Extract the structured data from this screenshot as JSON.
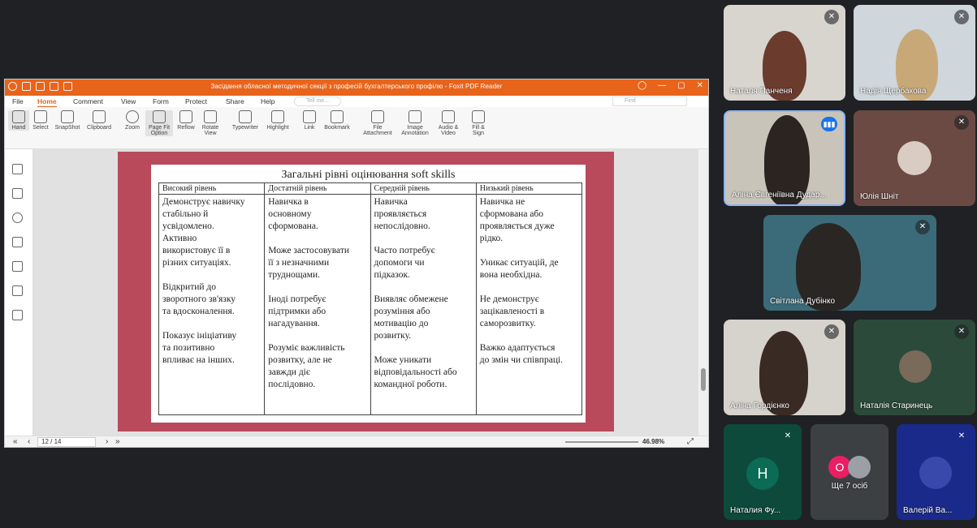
{
  "app": {
    "window_title": "Засідання обласної методичної секції з професій бухгалтерського профілю - Foxit PDF Reader"
  },
  "menu": [
    "File",
    "Home",
    "Comment",
    "View",
    "Form",
    "Protect",
    "Share",
    "Help"
  ],
  "tell_me_placeholder": "Tell me...",
  "find_placeholder": "Find",
  "ribbon": [
    {
      "label": "Hand"
    },
    {
      "label": "Select"
    },
    {
      "label": "SnapShot"
    },
    {
      "label": "Clipboard"
    },
    {
      "label": "Zoom"
    },
    {
      "label": "Page Fit Option"
    },
    {
      "label": "Reflow"
    },
    {
      "label": "Rotate View"
    },
    {
      "label": "Typewriter"
    },
    {
      "label": "Highlight"
    },
    {
      "label": "Link"
    },
    {
      "label": "Bookmark"
    },
    {
      "label": "File Attachment"
    },
    {
      "label": "Image Annotation"
    },
    {
      "label": "Audio & Video"
    },
    {
      "label": "Fill & Sign"
    }
  ],
  "status": {
    "page": "12 / 14",
    "zoom": "46.98%"
  },
  "slide": {
    "title": "Загальні рівні оцінювання soft skills",
    "columns": [
      {
        "header": "Високий рівень",
        "body": "Демонструє навичку\nстабільно й\nусвідомлено.\nАктивно\nвикористовує її в\nрізних ситуаціях.\n\nВідкритий до\nзворотного зв'язку\nта вдосконалення.\n\nПоказує ініціативу\nта позитивно\nвпливає на інших."
      },
      {
        "header": "Достатній рівень",
        "body": "Навичка в\nосновному\nсформована.\n\nМоже застосовувати\nїї з незначними\nтруднощами.\n\nІноді потребує\nпідтримки або\nнагадування.\n\nРозуміє важливість\nрозвитку, але не\nзавжди діє\nпослідовно."
      },
      {
        "header": "Середній рівень",
        "body": "Навичка\nпроявляється\nнепослідовно.\n\nЧасто потребує\nдопомоги чи\nпідказок.\n\nВиявляє обмежене\nрозуміння або\nмотивацію до\nрозвитку.\n\nМоже уникати\nвідповідальності або\nкомандної роботи."
      },
      {
        "header": "Низький рівень",
        "body": "Навичка не\nсформована або\nпроявляється дуже\nрідко.\n\nУникає ситуацій, де\nвона необхідна.\n\nНе демонструє\nзацікавленості в\nсаморозвитку.\n\nВажко адаптується\nдо змін чи співпраці."
      }
    ]
  },
  "participants": [
    {
      "name": "Наталя Панченя",
      "muted": true
    },
    {
      "name": "Надія Щербакова",
      "muted": true
    },
    {
      "name": "Аліна Євгеніївна Дудар...",
      "speaking": true
    },
    {
      "name": "Юлія Шніт",
      "muted": true
    },
    {
      "name": "Світлана Дубінко",
      "muted": true
    },
    {
      "name": "Аліна Гордієнко",
      "muted": true
    },
    {
      "name": "Наталія Старинець",
      "muted": true
    },
    {
      "name": "Наталия Фу...",
      "muted": true,
      "initial": "Н"
    },
    {
      "name": "Ще 7 осіб",
      "initial": "О"
    },
    {
      "name": "Валерій Ва...",
      "muted": true
    }
  ],
  "colors": {
    "foxit_orange": "#e8641b",
    "slide_frame": "#b84a5c",
    "avatar_green": "#0b6b55",
    "avatar_pink": "#e91e63",
    "meet_blue": "#1a73e8"
  }
}
